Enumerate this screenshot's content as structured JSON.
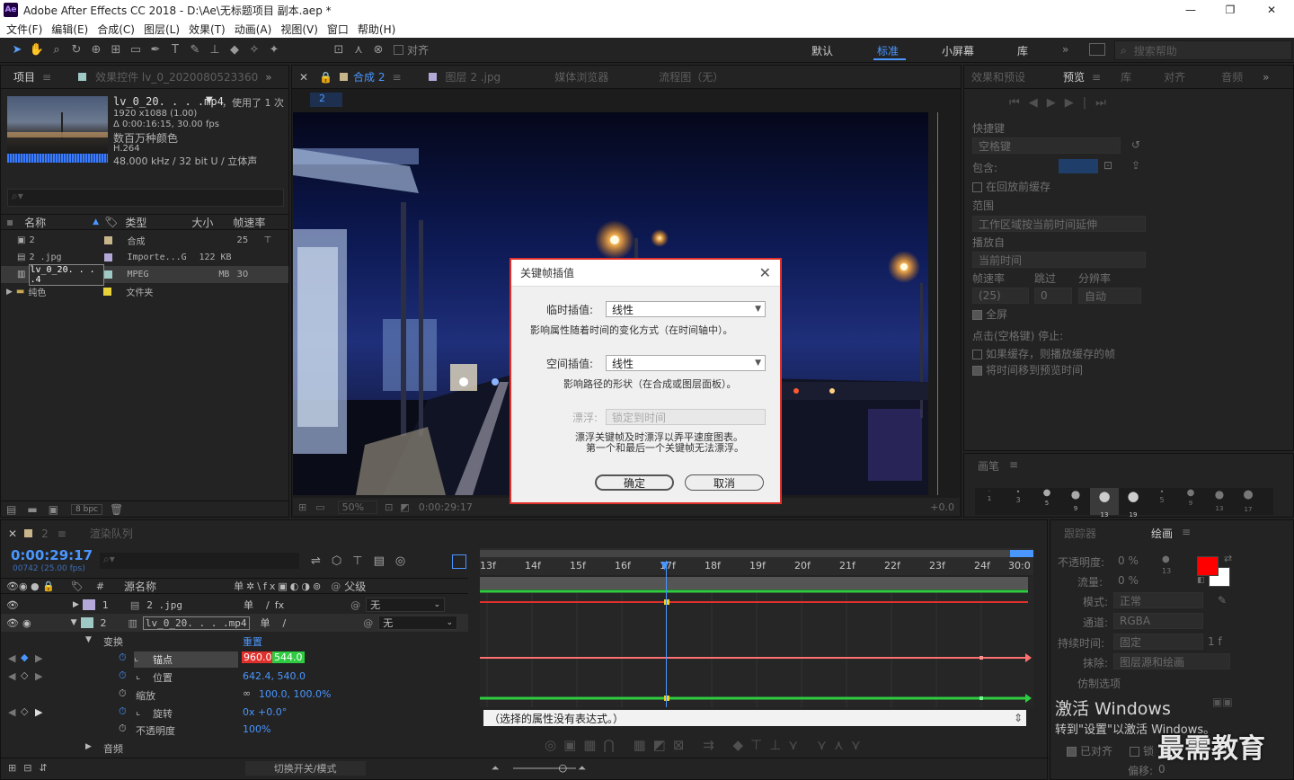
{
  "window": {
    "title": "Adobe After Effects CC 2018 - D:\\Ae\\无标题项目 副本.aep *",
    "app_icon": "Ae",
    "minimize": "—",
    "maximize": "❐",
    "close": "✕"
  },
  "menu": [
    "文件(F)",
    "编辑(E)",
    "合成(C)",
    "图层(L)",
    "效果(T)",
    "动画(A)",
    "视图(V)",
    "窗口",
    "帮助(H)"
  ],
  "toolbar": {
    "align_label": "对齐",
    "workspaces": [
      "默认",
      "标准",
      "小屏幕",
      "库"
    ],
    "active_workspace": "标准",
    "search_placeholder": "搜索帮助"
  },
  "project_panel": {
    "tab_project": "项目",
    "tab_effects": "效果控件 lv_0_2020080523360",
    "file_name": "lv_0_20. . . .mp4",
    "used": "，使用了 1 次",
    "info": [
      "1920 x1088 (1.00)",
      "Δ 0:00:16:15, 30.00 fps",
      "数百万种颜色",
      "H.264",
      "48.000 kHz / 32 bit U / 立体声"
    ],
    "columns": [
      "名称",
      "类型",
      "大小",
      "帧速率"
    ],
    "items": [
      {
        "name": "2",
        "type": "合成",
        "size": "",
        "fps": "25",
        "color": "#c9b58a"
      },
      {
        "name": "2 .jpg",
        "type": "Importe...G",
        "size": "122 KB",
        "fps": "",
        "color": "#b4a8d8"
      },
      {
        "name": "lv_0_20. . . .4",
        "type": "MPEG",
        "size": "MB",
        "fps": "30",
        "color": "#9ec9c4"
      },
      {
        "name": "纯色",
        "type": "文件夹",
        "size": "",
        "fps": "",
        "color": "#e8d23a"
      }
    ],
    "bpc": "8 bpc"
  },
  "comp_panel": {
    "tab_comp": "合成 2",
    "tab_layer": "图层 2 .jpg",
    "tab_media": "媒体浏览器",
    "tab_flow": "流程图（无）",
    "comp_chip": "2",
    "zoom": "50%",
    "timecode": "0:00:29:17",
    "offset": "+0.0"
  },
  "dialog": {
    "title": "关键帧插值",
    "temporal_label": "临时插值:",
    "temporal_value": "线性",
    "temporal_desc": "影响属性随着时间的变化方式（在时间轴中）。",
    "spatial_label": "空间插值:",
    "spatial_value": "线性",
    "spatial_desc": "影响路径的形状（在合成或图层面板）。",
    "roving_label": "漂浮:",
    "roving_value": "锁定到时间",
    "roving_desc1": "漂浮关键帧及时漂浮以弄平速度图表。",
    "roving_desc2": "第一个和最后一个关键帧无法漂浮。",
    "ok": "确定",
    "cancel": "取消"
  },
  "preview_panel": {
    "tabs": [
      "效果和预设",
      "预览",
      "库",
      "对齐",
      "音频"
    ],
    "shortcut_label": "快捷键",
    "shortcut_value": "空格键",
    "include_label": "包含:",
    "cache_label": "在回放前缓存",
    "range_label": "范围",
    "range_value": "工作区域按当前时间延伸",
    "play_from_label": "播放自",
    "play_from_value": "当前时间",
    "fps_label": "帧速率",
    "skip_label": "跳过",
    "res_label": "分辨率",
    "fps_value": "(25)",
    "skip_value": "0",
    "res_value": "自动",
    "fullscreen_label": "全屏",
    "stop_label": "点击(空格键) 停止:",
    "stop_opt1": "如果缓存，则播放缓存的帧",
    "stop_opt2": "将时间移到预览时间",
    "brush_tab": "画笔",
    "brush_sizes": [
      "1",
      "3",
      "5",
      "9",
      "13",
      "19",
      "5",
      "9",
      "13",
      "17"
    ]
  },
  "paint_panel": {
    "tabs": [
      "跟踪器",
      "绘画"
    ],
    "opacity_label": "不透明度:",
    "opacity_value": "0 %",
    "flow_label": "流量:",
    "flow_value": "0 %",
    "mode_label": "模式:",
    "mode_value": "正常",
    "channel_label": "通道:",
    "channel_value": "RGBA",
    "duration_label": "持续时间:",
    "duration_value": "固定",
    "duration_frames": "1 f",
    "erase_label": "抹除:",
    "erase_value": "图层源和绘画",
    "clone_label": "仿制选项",
    "aligned_label": "已对齐",
    "lock_label": "锁",
    "offset_label": "偏移:",
    "offset_value": "0",
    "fg_color": "#ff0000",
    "bg_color": "#ffffff",
    "brush_value": "13"
  },
  "watermark": {
    "win1": "激活 Windows",
    "win2": "转到\"设置\"以激活 Windows。",
    "brand": "最需教育"
  },
  "timeline": {
    "tab_comp": "2",
    "tab_render": "渲染队列",
    "timecode": "0:00:29:17",
    "timecode_sub": "00742 (25.00 fps)",
    "col_num": "#",
    "col_name": "源名称",
    "col_parent": "父级",
    "ruler": [
      "13f",
      "14f",
      "15f",
      "16f",
      "17f",
      "18f",
      "19f",
      "20f",
      "21f",
      "22f",
      "23f",
      "24f",
      "30:0"
    ],
    "layers": [
      {
        "num": "1",
        "name": "2 .jpg",
        "parent": "无",
        "color": "#b4a8d8"
      },
      {
        "num": "2",
        "name": "lv_0_20. . . .mp4",
        "parent": "无",
        "color": "#9ec9c4"
      }
    ],
    "transform_label": "变换",
    "reset_label": "重置",
    "props": [
      {
        "name": "锚点",
        "value1": "960.0",
        "value2": "544.0"
      },
      {
        "name": "位置",
        "value": "642.4, 540.0"
      },
      {
        "name": "缩放",
        "value": "100.0, 100.0%"
      },
      {
        "name": "旋转",
        "value": "0x +0.0°"
      },
      {
        "name": "不透明度",
        "value": "100%"
      }
    ],
    "audio_label": "音频",
    "expression_text": "（选择的属性没有表达式。）",
    "toggle_label": "切换开关/模式"
  }
}
